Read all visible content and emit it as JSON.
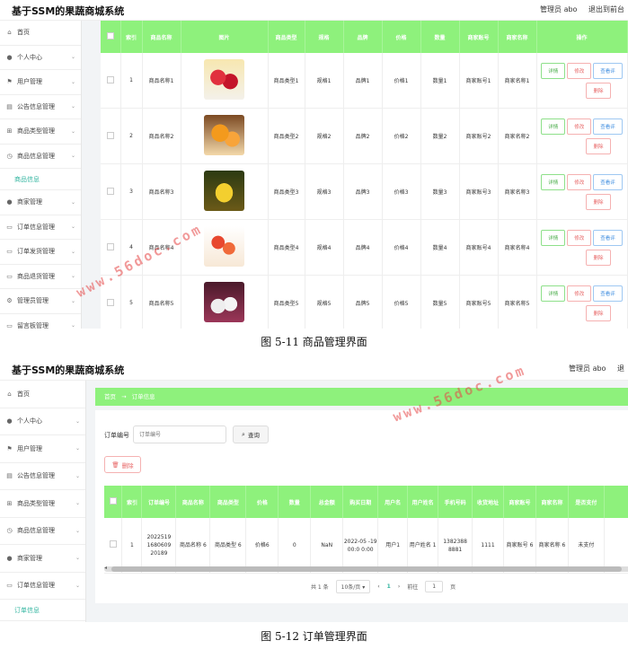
{
  "app_title": "基于SSM的果蔬商城系统",
  "user": {
    "role_label": "管理员 abo",
    "logout_label_1": "退出到前台",
    "logout_label_2": "退"
  },
  "sidebar1": {
    "items": [
      {
        "icon": "home-icon",
        "label": "首页"
      },
      {
        "icon": "user-icon",
        "label": "个人中心"
      },
      {
        "icon": "flag-icon",
        "label": "用户管理"
      },
      {
        "icon": "clipboard-icon",
        "label": "公告信息管理"
      },
      {
        "icon": "grid-icon",
        "label": "商品类型管理"
      },
      {
        "icon": "clock-icon",
        "label": "商品信息管理"
      }
    ],
    "sub_item": "商品信息",
    "items_after": [
      {
        "icon": "user-icon",
        "label": "商家管理"
      },
      {
        "icon": "chat-icon",
        "label": "订单信息管理"
      },
      {
        "icon": "chat-icon",
        "label": "订单发货管理"
      },
      {
        "icon": "chat-icon",
        "label": "商品退货管理"
      },
      {
        "icon": "gear-icon",
        "label": "管理员管理"
      },
      {
        "icon": "chat-icon",
        "label": "留言板管理"
      }
    ]
  },
  "product_table": {
    "headers": [
      "索引",
      "商品名称",
      "图片",
      "商品类型",
      "规格",
      "品牌",
      "价格",
      "数量",
      "商家账号",
      "商家名称",
      "操作"
    ],
    "rows": [
      {
        "idx": "1",
        "name": "商品名称1",
        "type": "商品类型1",
        "spec": "规格1",
        "brand": "品牌1",
        "price": "价格1",
        "qty": "数量1",
        "acct": "商家账号1",
        "merchant": "商家名称1"
      },
      {
        "idx": "2",
        "name": "商品名称2",
        "type": "商品类型2",
        "spec": "规格2",
        "brand": "品牌2",
        "price": "价格2",
        "qty": "数量2",
        "acct": "商家账号2",
        "merchant": "商家名称2"
      },
      {
        "idx": "3",
        "name": "商品名称3",
        "type": "商品类型3",
        "spec": "规格3",
        "brand": "品牌3",
        "price": "价格3",
        "qty": "数量3",
        "acct": "商家账号3",
        "merchant": "商家名称3"
      },
      {
        "idx": "4",
        "name": "商品名称4",
        "type": "商品类型4",
        "spec": "规格4",
        "brand": "品牌4",
        "price": "价格4",
        "qty": "数量4",
        "acct": "商家账号4",
        "merchant": "商家名称4"
      },
      {
        "idx": "5",
        "name": "商品名称5",
        "type": "商品类型5",
        "spec": "规格5",
        "brand": "品牌5",
        "price": "价格5",
        "qty": "数量5",
        "acct": "商家账号5",
        "merchant": "商家名称5"
      }
    ],
    "actions": {
      "detail": "详情",
      "edit": "修改",
      "review": "查看评",
      "delete": "删除"
    }
  },
  "caption1": "图 5-11 商品管理界面",
  "sidebar2": {
    "items": [
      {
        "icon": "home-icon",
        "label": "首页"
      },
      {
        "icon": "user-icon",
        "label": "个人中心"
      },
      {
        "icon": "flag-icon",
        "label": "用户管理"
      },
      {
        "icon": "clipboard-icon",
        "label": "公告信息管理"
      },
      {
        "icon": "grid-icon",
        "label": "商品类型管理"
      },
      {
        "icon": "clock-icon",
        "label": "商品信息管理"
      },
      {
        "icon": "user-icon",
        "label": "商家管理"
      },
      {
        "icon": "chat-icon",
        "label": "订单信息管理"
      }
    ],
    "sub_item": "订单信息"
  },
  "breadcrumb": {
    "home": "首页",
    "sep": "→",
    "current": "订单信息"
  },
  "order_search": {
    "label": "订单编号",
    "placeholder": "订单编号",
    "button": "查询"
  },
  "delete_button": "删除",
  "order_table": {
    "headers": [
      "索引",
      "订单编号",
      "商品名称",
      "商品类型",
      "价格",
      "数量",
      "总金额",
      "购买日期",
      "用户名",
      "用户姓名",
      "手机号码",
      "收货地址",
      "商家账号",
      "商家名称",
      "是否支付"
    ],
    "row": {
      "idx": "1",
      "order_no": "2022519 1680609 20189",
      "name": "商品名称 6",
      "type": "商品类型 6",
      "price": "价格6",
      "qty": "0",
      "total": "NaN",
      "date": "2022-05 -19 00:0 0:00",
      "username": "用户1",
      "realname": "用户姓名 1",
      "phone": "1382388 8881",
      "address": "1111",
      "acct": "商家账号 6",
      "merchant": "商家名称 6",
      "paid": "未支付"
    }
  },
  "pagination": {
    "total": "共 1 条",
    "page_size": "10条/页",
    "prev": "‹",
    "page": "1",
    "next": "›",
    "goto": "前往",
    "goto_value": "1",
    "page_suffix": "页"
  },
  "caption2": "图 5-12 订单管理界面",
  "watermark": "www.56doc.com",
  "colors": {
    "accent_green": "#8ef17c",
    "link_teal": "#33b5a0",
    "watermark": "#e64646"
  }
}
